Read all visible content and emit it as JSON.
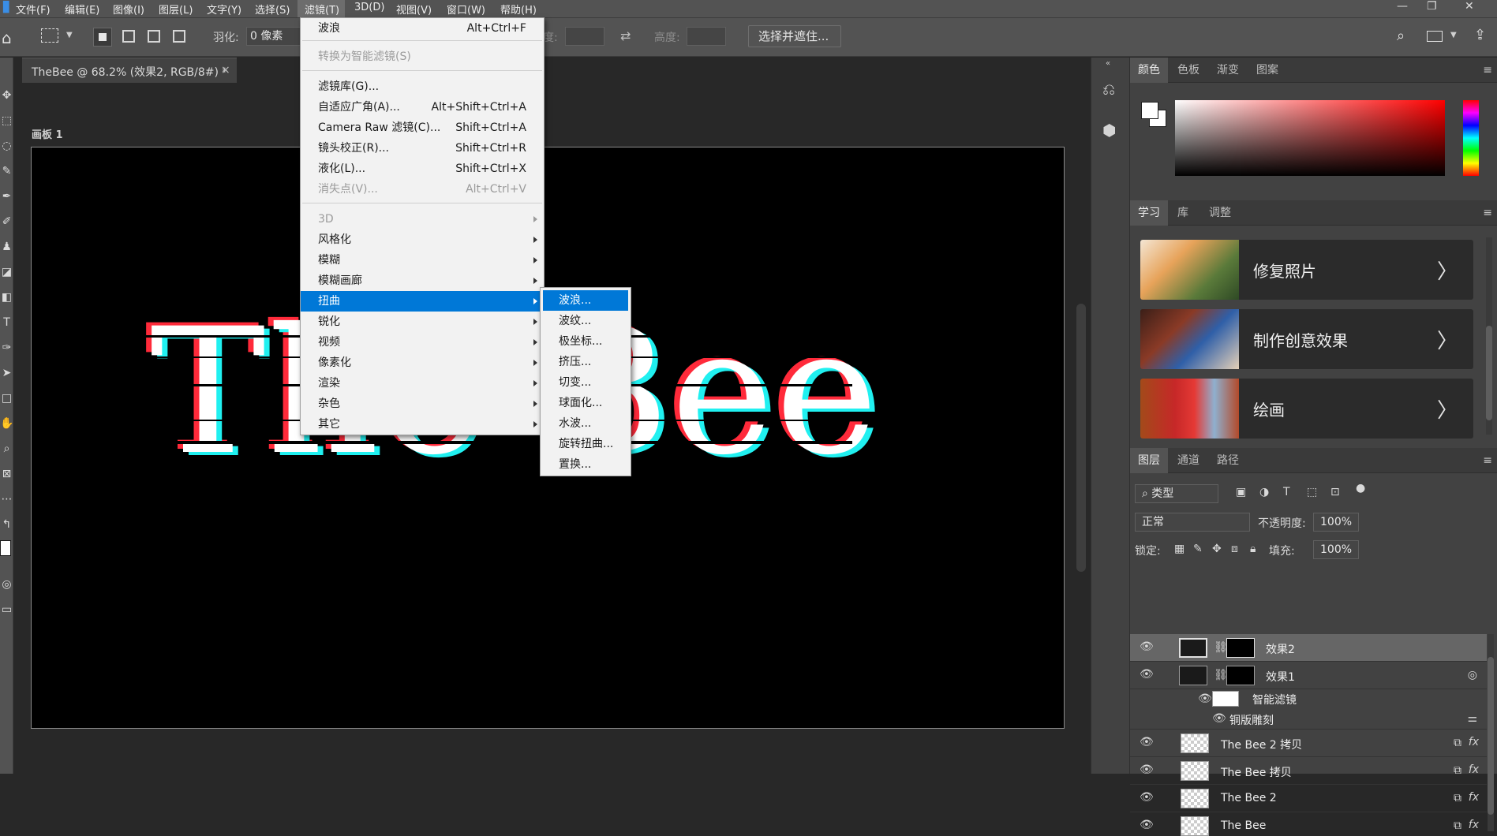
{
  "menubar": {
    "items": [
      "文件(F)",
      "编辑(E)",
      "图像(I)",
      "图层(L)",
      "文字(Y)",
      "选择(S)",
      "滤镜(T)",
      "3D(D)",
      "视图(V)",
      "窗口(W)",
      "帮助(H)"
    ],
    "window_controls": [
      "—",
      "❐",
      "✕"
    ]
  },
  "options": {
    "feather_label": "羽化:",
    "feather_value": "0 像素",
    "width_label": "度:",
    "height_label": "高度:",
    "select_mask_button": "选择并遮住..."
  },
  "document": {
    "tab_title": "TheBee @ 68.2% (效果2, RGB/8#) *",
    "tab_close": "×",
    "artboard_label": "画板 1",
    "canvas_text": "The Bee"
  },
  "filter_menu": {
    "items": [
      {
        "label": "波浪",
        "shortcut": "Alt+Ctrl+F"
      },
      {
        "label": "转换为智能滤镜(S)",
        "shortcut": "",
        "disabled": true
      },
      {
        "label": "滤镜库(G)...",
        "shortcut": ""
      },
      {
        "label": "自适应广角(A)...",
        "shortcut": "Alt+Shift+Ctrl+A"
      },
      {
        "label": "Camera Raw 滤镜(C)...",
        "shortcut": "Shift+Ctrl+A"
      },
      {
        "label": "镜头校正(R)...",
        "shortcut": "Shift+Ctrl+R"
      },
      {
        "label": "液化(L)...",
        "shortcut": "Shift+Ctrl+X"
      },
      {
        "label": "消失点(V)...",
        "shortcut": "Alt+Ctrl+V",
        "disabled": true
      },
      {
        "label": "3D",
        "disabled": true
      },
      {
        "label": "风格化"
      },
      {
        "label": "模糊"
      },
      {
        "label": "模糊画廊"
      },
      {
        "label": "扭曲",
        "highlighted": true
      },
      {
        "label": "锐化"
      },
      {
        "label": "视频"
      },
      {
        "label": "像素化"
      },
      {
        "label": "渲染"
      },
      {
        "label": "杂色"
      },
      {
        "label": "其它"
      }
    ]
  },
  "distort_submenu": {
    "items": [
      "波浪...",
      "波纹...",
      "极坐标...",
      "挤压...",
      "切变...",
      "球面化...",
      "水波...",
      "旋转扭曲...",
      "置换..."
    ]
  },
  "color_panel": {
    "tabs": [
      "颜色",
      "色板",
      "渐变",
      "图案"
    ],
    "menu_icon": "≡"
  },
  "learn_panel": {
    "tabs": [
      "学习",
      "库",
      "调整"
    ],
    "cards": [
      {
        "title": "修复照片",
        "arrow": "〉"
      },
      {
        "title": "制作创意效果",
        "arrow": "〉"
      },
      {
        "title": "绘画",
        "arrow": "〉"
      }
    ]
  },
  "layers_panel": {
    "tabs": [
      "图层",
      "通道",
      "路径"
    ],
    "filter_kind": "类型",
    "blend_mode": "正常",
    "opacity_label": "不透明度:",
    "opacity_value": "100%",
    "lock_label": "锁定:",
    "fill_label": "填充:",
    "fill_value": "100%",
    "layers": [
      {
        "name": "效果2",
        "selected": true
      },
      {
        "name": "效果1"
      },
      {
        "name": "智能滤镜"
      },
      {
        "name": "铜版雕刻"
      },
      {
        "name": "The Bee 2 拷贝",
        "fx": "fx"
      },
      {
        "name": "The Bee 拷贝",
        "fx": "fx"
      },
      {
        "name": "The Bee 2",
        "fx": "fx"
      },
      {
        "name": "The Bee",
        "fx": "fx"
      }
    ]
  },
  "colors": {
    "highlight": "#0078d7",
    "ui_dark": "#424242",
    "bee_red": "#ff2a3a",
    "bee_cyan": "#20f0f0"
  }
}
